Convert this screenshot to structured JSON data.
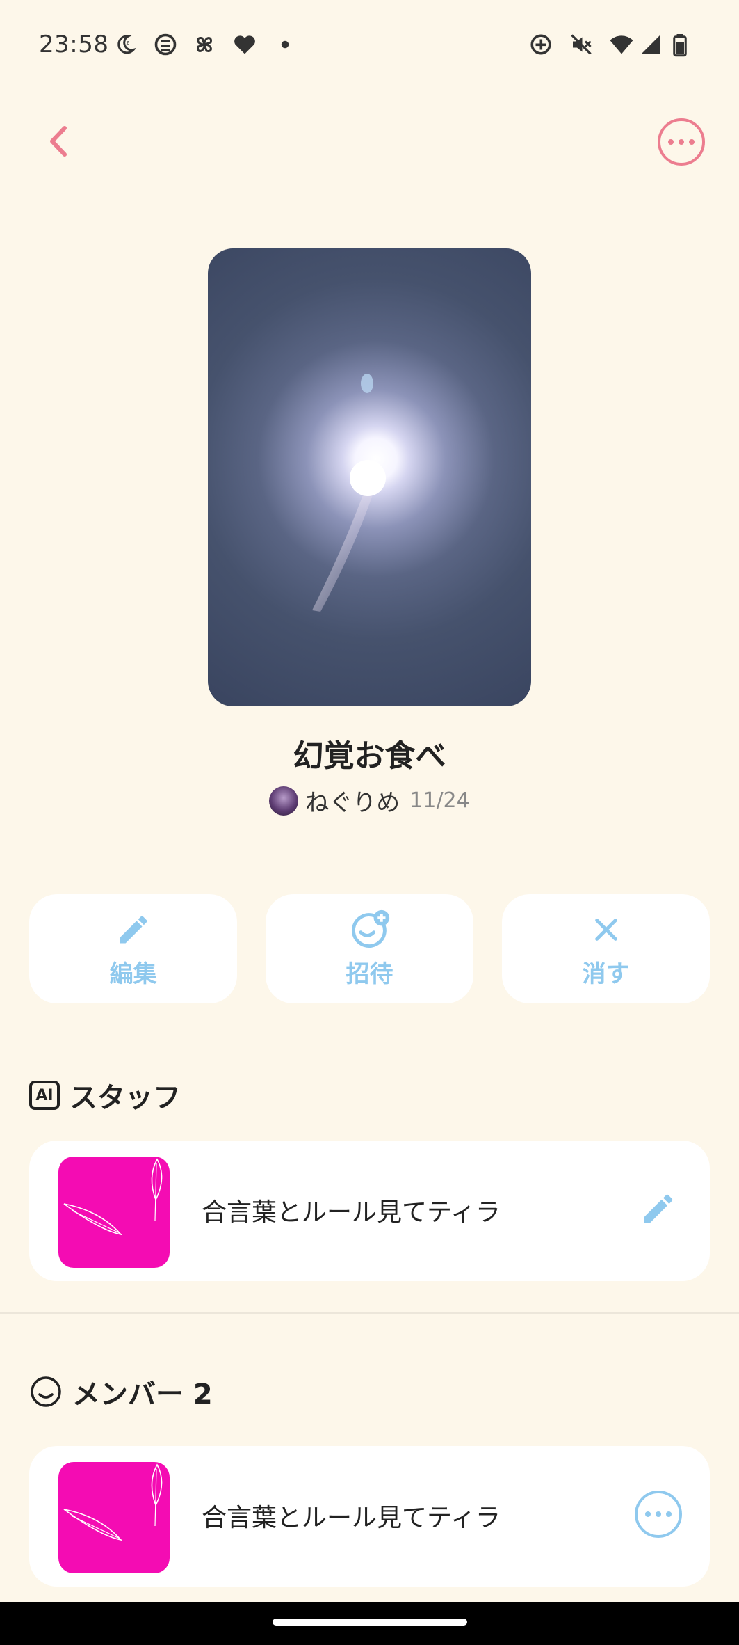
{
  "status_bar": {
    "time": "23:58",
    "icons_left": [
      "moon-icon",
      "chat-bubble-icon",
      "pinwheel-icon",
      "heart-icon",
      "dot-icon"
    ],
    "icons_right": [
      "sync-icon",
      "mute-icon",
      "wifi-icon",
      "signal-icon",
      "battery-icon"
    ]
  },
  "header": {
    "back_icon": "chevron-left-icon",
    "more_icon": "more-horizontal-icon",
    "accent_color": "#ec7d8f"
  },
  "room": {
    "title": "幻覚お食べ",
    "owner_name": "ねぐりめ",
    "date": "11/24"
  },
  "actions": [
    {
      "label": "編集",
      "icon": "pencil-icon"
    },
    {
      "label": "招待",
      "icon": "invite-face-icon"
    },
    {
      "label": "消す",
      "icon": "close-icon"
    }
  ],
  "staff_section": {
    "badge": "AI",
    "title": "スタッフ",
    "items": [
      {
        "name": "合言葉とルール見てティラ",
        "action_icon": "pencil-icon"
      }
    ]
  },
  "member_section": {
    "title": "メンバー 2",
    "items": [
      {
        "name": "合言葉とルール見てティラ",
        "action_icon": "more-horizontal-icon"
      }
    ]
  },
  "colors": {
    "background": "#fdf7ea",
    "action_blue": "#8fc9ee",
    "thumbnail_pink": "#f40cb3"
  }
}
